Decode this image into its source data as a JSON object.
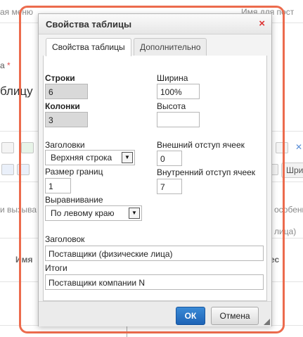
{
  "background": {
    "menu_title_partial": "ая меню",
    "column_name_partial": "Имя для пост",
    "required_label_partial": "а",
    "required_mark": "*",
    "heading_partial": "блицу",
    "hint_left_partial": "и вызыва",
    "hint_right_partial": "особенн",
    "hint_right_partial2": "лица)",
    "table_header_left": "Имя",
    "table_header_right": "ес",
    "toolbar_button_partial": "Шри"
  },
  "dialog": {
    "title": "Свойства таблицы",
    "close_symbol": "×",
    "tabs": [
      {
        "label": "Свойства таблицы",
        "active": true
      },
      {
        "label": "Дополнительно",
        "active": false
      }
    ],
    "rows_label": "Строки",
    "rows_value": "6",
    "cols_label": "Колонки",
    "cols_value": "3",
    "width_label": "Ширина",
    "width_value": "100%",
    "height_label": "Высота",
    "height_value": "",
    "headers_label": "Заголовки",
    "headers_value": "Верхняя строка",
    "border_label": "Размер границ",
    "border_value": "1",
    "align_label": "Выравнивание",
    "align_value": "По левому краю",
    "spacing_label": "Внешний отступ ячеек",
    "spacing_value": "0",
    "padding_label": "Внутренний отступ ячеек",
    "padding_value": "7",
    "caption_label": "Заголовок",
    "caption_value": "Поставщики (физические лица)",
    "summary_label": "Итоги",
    "summary_value": "Поставщики компании N",
    "ok_label": "ОК",
    "cancel_label": "Отмена",
    "dropdown_arrow": "▼"
  },
  "colors": {
    "highlight_frame": "#ec6b4d",
    "ok_button": "#1d63b6",
    "close_icon": "#dd3333"
  }
}
